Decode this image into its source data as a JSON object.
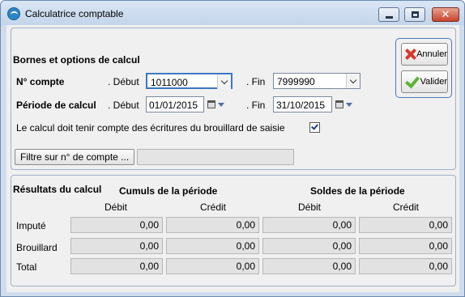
{
  "window": {
    "title": "Calculatrice comptable"
  },
  "buttons": {
    "cancel_label": "Annuler",
    "validate_label": "Valider"
  },
  "bounds": {
    "heading": "Bornes et options de calcul",
    "account_label": "N° compte",
    "start_label": ". Début",
    "end_label": ". Fin",
    "account_start": "1011000",
    "account_end": "7999990",
    "period_label": "Période de calcul",
    "period_start": "01/01/2015",
    "period_end": "31/10/2015",
    "include_draft_label": "Le calcul doit tenir compte des écritures du brouillard de saisie",
    "include_draft_checked": true,
    "filter_button_label": "Filtre sur n° de compte ...",
    "filter_value": ""
  },
  "results": {
    "heading": "Résultats du calcul",
    "cumuls_heading": "Cumuls de la période",
    "soldes_heading": "Soldes de la période",
    "columns": [
      "Débit",
      "Crédit",
      "Débit",
      "Crédit"
    ],
    "rows": [
      {
        "label": "Imputé",
        "values": [
          "0,00",
          "0,00",
          "0,00",
          "0,00"
        ]
      },
      {
        "label": "Brouillard",
        "values": [
          "0,00",
          "0,00",
          "0,00",
          "0,00"
        ]
      },
      {
        "label": "Total",
        "values": [
          "0,00",
          "0,00",
          "0,00",
          "0,00"
        ]
      }
    ]
  }
}
